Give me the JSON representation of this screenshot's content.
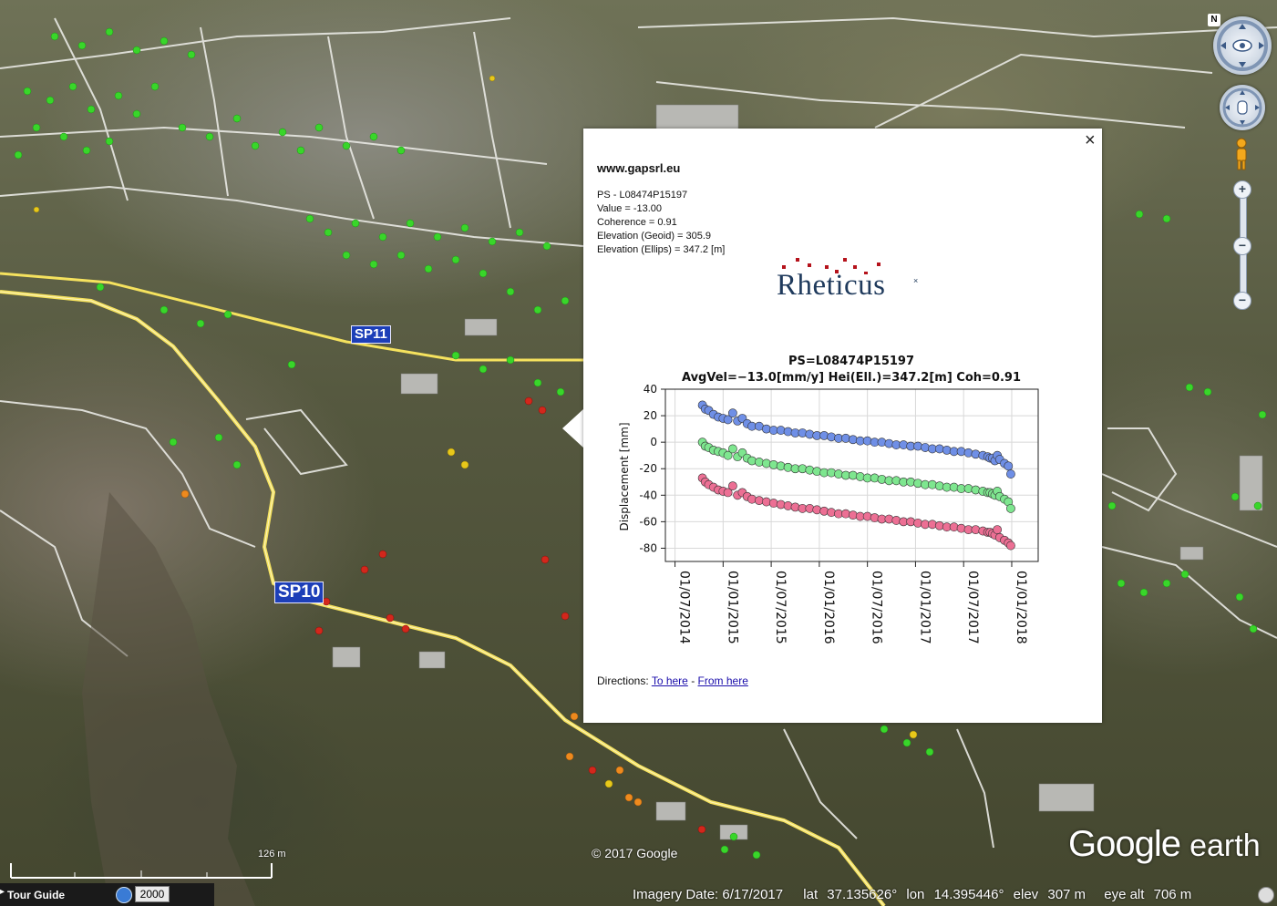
{
  "map": {
    "road_labels": [
      "SP11",
      "SP10"
    ],
    "copyright": "© 2017 Google",
    "watermark_google": "Google",
    "watermark_earth": "earth",
    "scale_label": "126 m"
  },
  "popup": {
    "close_glyph": "×",
    "site": "www.gapsrl.eu",
    "info": [
      "PS - L08474P15197",
      "Value = -13.00",
      "Coherence = 0.91",
      "Elevation (Geoid) = 305.9",
      "Elevation (Ellips) = 347.2 [m]"
    ],
    "logo_text": "Rheticus",
    "logo_mark": "×",
    "directions_label": "Directions:",
    "to_here": "To here",
    "separator": "-",
    "from_here": "From here"
  },
  "chart_data": {
    "type": "scatter",
    "title": "PS=L08474P15197",
    "subtitle": "AvgVel=−13.0[mm/y] Hei(Ell.)=347.2[m] Coh=0.91",
    "ylabel": "Displacement [mm]",
    "xlabel": "",
    "ylim": [
      -90,
      40
    ],
    "yticks": [
      40,
      20,
      0,
      -20,
      -40,
      -60,
      -80
    ],
    "xticks": [
      "01/07/2014",
      "01/01/2015",
      "01/07/2015",
      "01/01/2016",
      "01/07/2016",
      "01/01/2017",
      "01/07/2017",
      "01/01/2018"
    ],
    "xlim_index": [
      -0.2,
      7.55
    ],
    "grid": true,
    "series": [
      {
        "color": "#6f8fe6",
        "offset": 0,
        "x": [
          0.57,
          0.63,
          0.7,
          0.8,
          0.9,
          1.0,
          1.1,
          1.2,
          1.3,
          1.4,
          1.5,
          1.6,
          1.75,
          1.9,
          2.05,
          2.2,
          2.35,
          2.5,
          2.65,
          2.8,
          2.95,
          3.1,
          3.25,
          3.4,
          3.55,
          3.7,
          3.85,
          4.0,
          4.15,
          4.3,
          4.45,
          4.6,
          4.75,
          4.9,
          5.05,
          5.2,
          5.35,
          5.5,
          5.65,
          5.8,
          5.95,
          6.1,
          6.25,
          6.4,
          6.5,
          6.55,
          6.6,
          6.65,
          6.7,
          6.75,
          6.85,
          6.93,
          6.98
        ],
        "y": [
          28,
          25,
          24,
          21,
          19,
          18,
          17,
          22,
          16,
          18,
          14,
          12,
          12,
          10,
          9,
          9,
          8,
          7,
          7,
          6,
          5,
          5,
          4,
          3,
          3,
          2,
          1,
          1,
          0,
          0,
          -1,
          -2,
          -2,
          -3,
          -3,
          -4,
          -5,
          -5,
          -6,
          -7,
          -7,
          -8,
          -9,
          -10,
          -11,
          -12,
          -12,
          -14,
          -10,
          -13,
          -16,
          -18,
          -24
        ]
      },
      {
        "color": "#7ee68f",
        "offset": 0,
        "x": [
          0.57,
          0.63,
          0.7,
          0.8,
          0.9,
          1.0,
          1.1,
          1.2,
          1.3,
          1.4,
          1.5,
          1.6,
          1.75,
          1.9,
          2.05,
          2.2,
          2.35,
          2.5,
          2.65,
          2.8,
          2.95,
          3.1,
          3.25,
          3.4,
          3.55,
          3.7,
          3.85,
          4.0,
          4.15,
          4.3,
          4.45,
          4.6,
          4.75,
          4.9,
          5.05,
          5.2,
          5.35,
          5.5,
          5.65,
          5.8,
          5.95,
          6.1,
          6.25,
          6.4,
          6.5,
          6.55,
          6.6,
          6.65,
          6.7,
          6.75,
          6.85,
          6.93,
          6.98
        ],
        "y": [
          0,
          -3,
          -4,
          -6,
          -7,
          -8,
          -10,
          -5,
          -11,
          -8,
          -12,
          -14,
          -15,
          -16,
          -17,
          -18,
          -19,
          -20,
          -20,
          -21,
          -22,
          -23,
          -23,
          -24,
          -25,
          -25,
          -26,
          -27,
          -27,
          -28,
          -29,
          -29,
          -30,
          -30,
          -31,
          -32,
          -32,
          -33,
          -34,
          -34,
          -35,
          -35,
          -36,
          -37,
          -38,
          -38,
          -39,
          -40,
          -37,
          -41,
          -43,
          -45,
          -50
        ]
      },
      {
        "color": "#ec6f94",
        "offset": 0,
        "x": [
          0.57,
          0.63,
          0.7,
          0.8,
          0.9,
          1.0,
          1.1,
          1.2,
          1.3,
          1.4,
          1.5,
          1.6,
          1.75,
          1.9,
          2.05,
          2.2,
          2.35,
          2.5,
          2.65,
          2.8,
          2.95,
          3.1,
          3.25,
          3.4,
          3.55,
          3.7,
          3.85,
          4.0,
          4.15,
          4.3,
          4.45,
          4.6,
          4.75,
          4.9,
          5.05,
          5.2,
          5.35,
          5.5,
          5.65,
          5.8,
          5.95,
          6.1,
          6.25,
          6.4,
          6.5,
          6.55,
          6.6,
          6.65,
          6.7,
          6.75,
          6.85,
          6.93,
          6.98
        ],
        "y": [
          -27,
          -30,
          -32,
          -34,
          -36,
          -37,
          -38,
          -33,
          -40,
          -38,
          -41,
          -43,
          -44,
          -45,
          -46,
          -47,
          -48,
          -49,
          -50,
          -50,
          -51,
          -52,
          -53,
          -54,
          -54,
          -55,
          -56,
          -56,
          -57,
          -58,
          -58,
          -59,
          -60,
          -60,
          -61,
          -62,
          -62,
          -63,
          -64,
          -64,
          -65,
          -66,
          -66,
          -67,
          -68,
          -68,
          -69,
          -70,
          -66,
          -72,
          -74,
          -76,
          -78
        ]
      }
    ]
  },
  "controls": {
    "compass_letter": "N",
    "zoom_in": "+",
    "zoom_slider": "−",
    "zoom_out": "−"
  },
  "bottom": {
    "tour_arrow": "▸",
    "tour_guide": "Tour Guide",
    "year": "2000",
    "imagery_date": "Imagery Date: 6/17/2017",
    "lat_label": "lat",
    "lat_value": "37.135626°",
    "lon_label": "lon",
    "lon_value": "14.395446°",
    "elev_label": "elev",
    "elev_value": "307 m",
    "eye_label": "eye alt",
    "eye_value": "706 m"
  },
  "colors": {
    "marker_green": "#39d62a",
    "marker_red": "#d3271c",
    "marker_orange": "#ee8a1e",
    "marker_yellow": "#e8c81a",
    "road_yellow": "#f0df5a",
    "road_label_bg": "#1d3fb8"
  }
}
